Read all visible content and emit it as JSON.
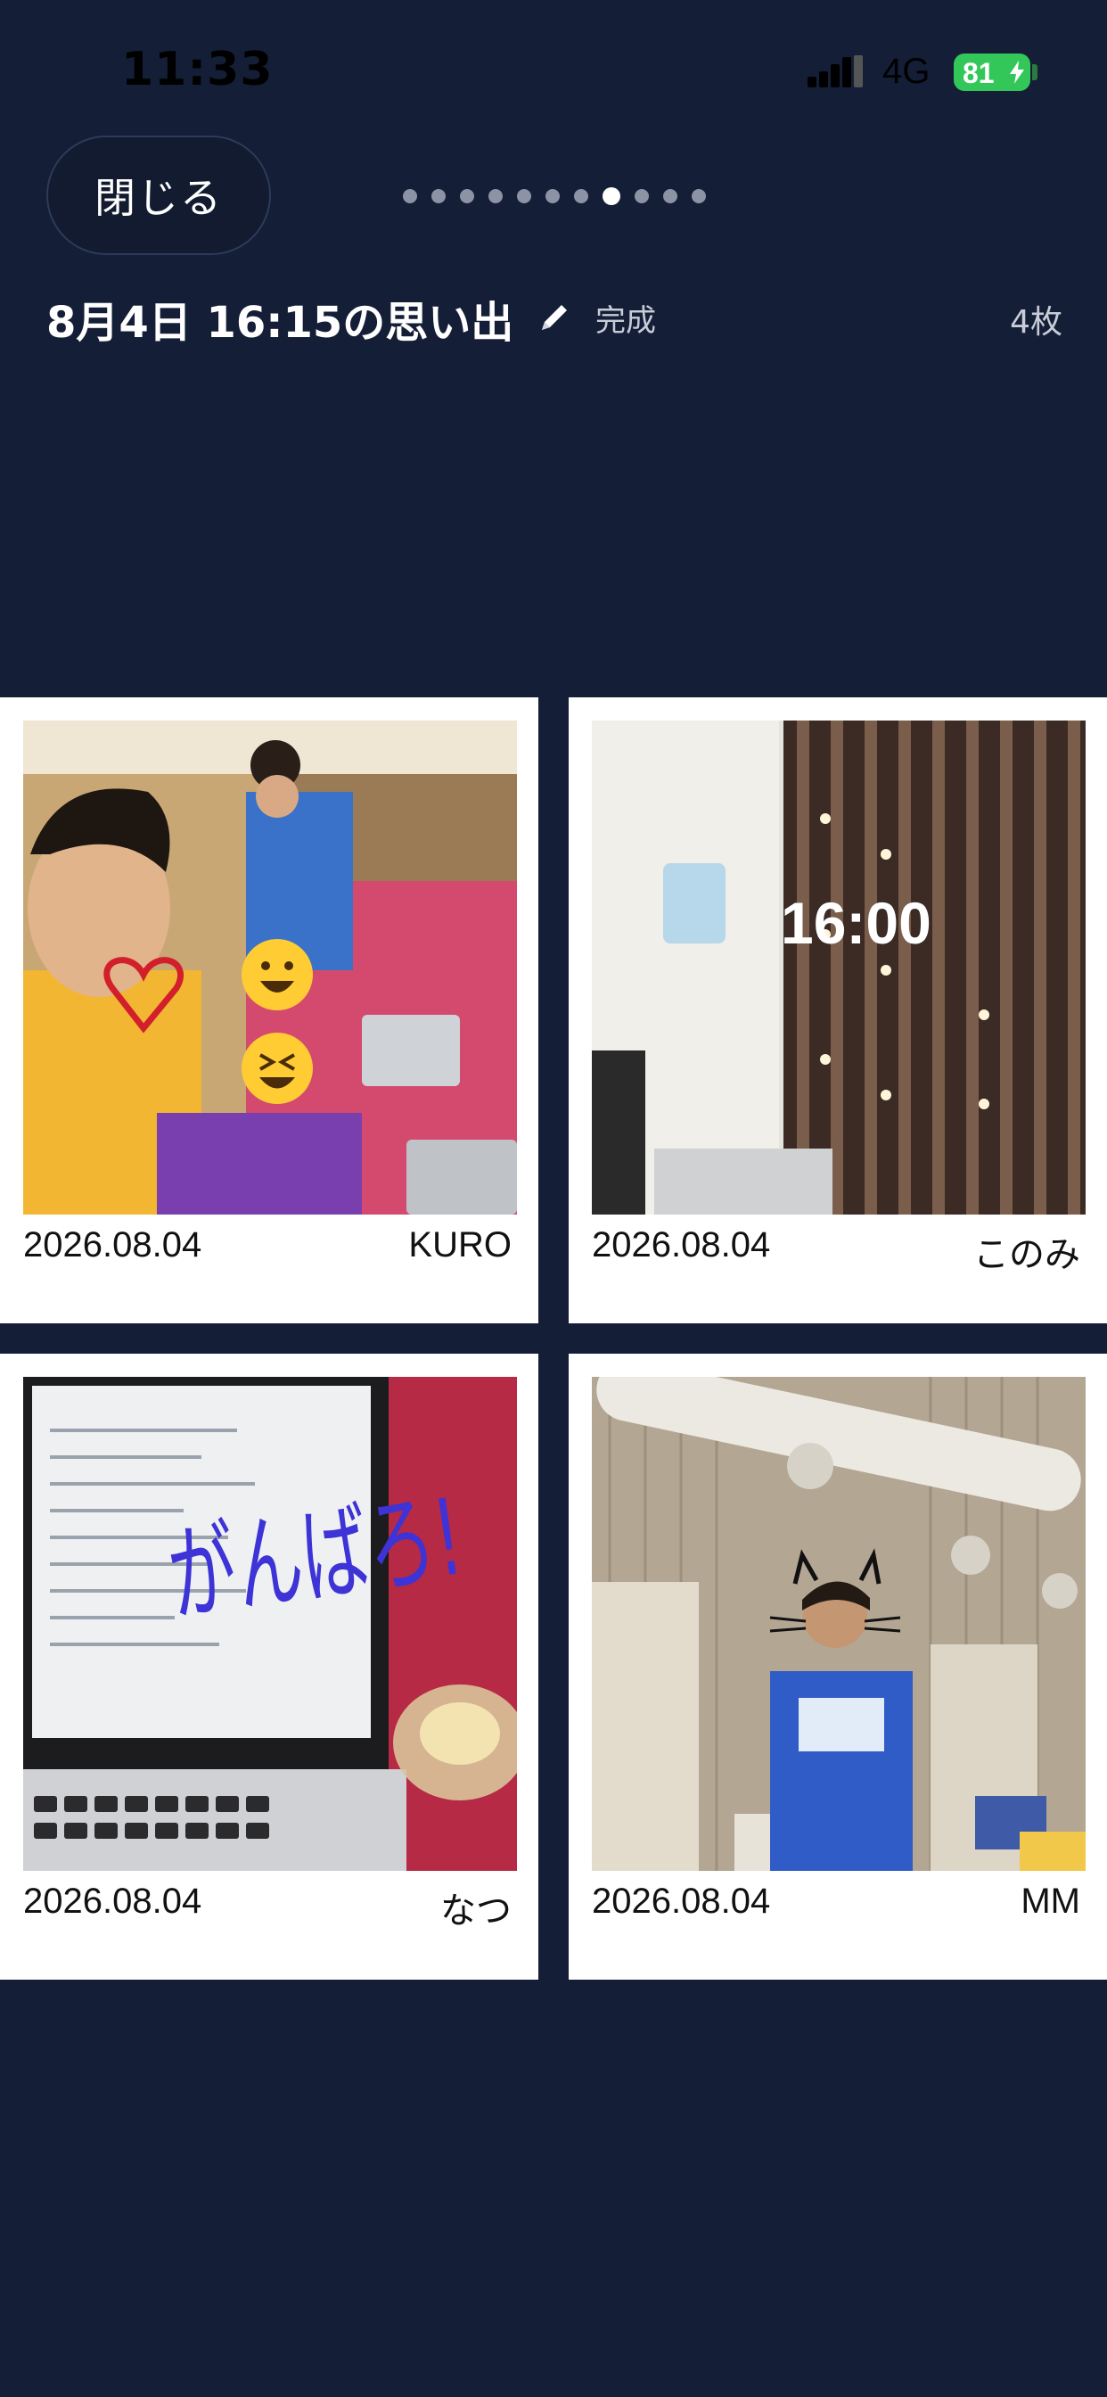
{
  "status_bar": {
    "time": "11:33",
    "network": "4G",
    "battery": "81"
  },
  "nav": {
    "close_label": "閉じる",
    "page_count": 11,
    "active_page": 7
  },
  "album": {
    "title": "8月4日 16:15の思い出",
    "edit_icon": "pencil-icon",
    "status": "完成",
    "photo_count": "4枚"
  },
  "photos": [
    {
      "date": "2026.08.04",
      "author": "KURO"
    },
    {
      "date": "2026.08.04",
      "author": "このみ",
      "overlay_text": "16:00"
    },
    {
      "date": "2026.08.04",
      "author": "なつ",
      "doodle_text": "がんばろ!"
    },
    {
      "date": "2026.08.04",
      "author": "MM"
    }
  ],
  "colors": {
    "background": "#141e36",
    "battery": "#33c759",
    "card": "#ffffff"
  }
}
